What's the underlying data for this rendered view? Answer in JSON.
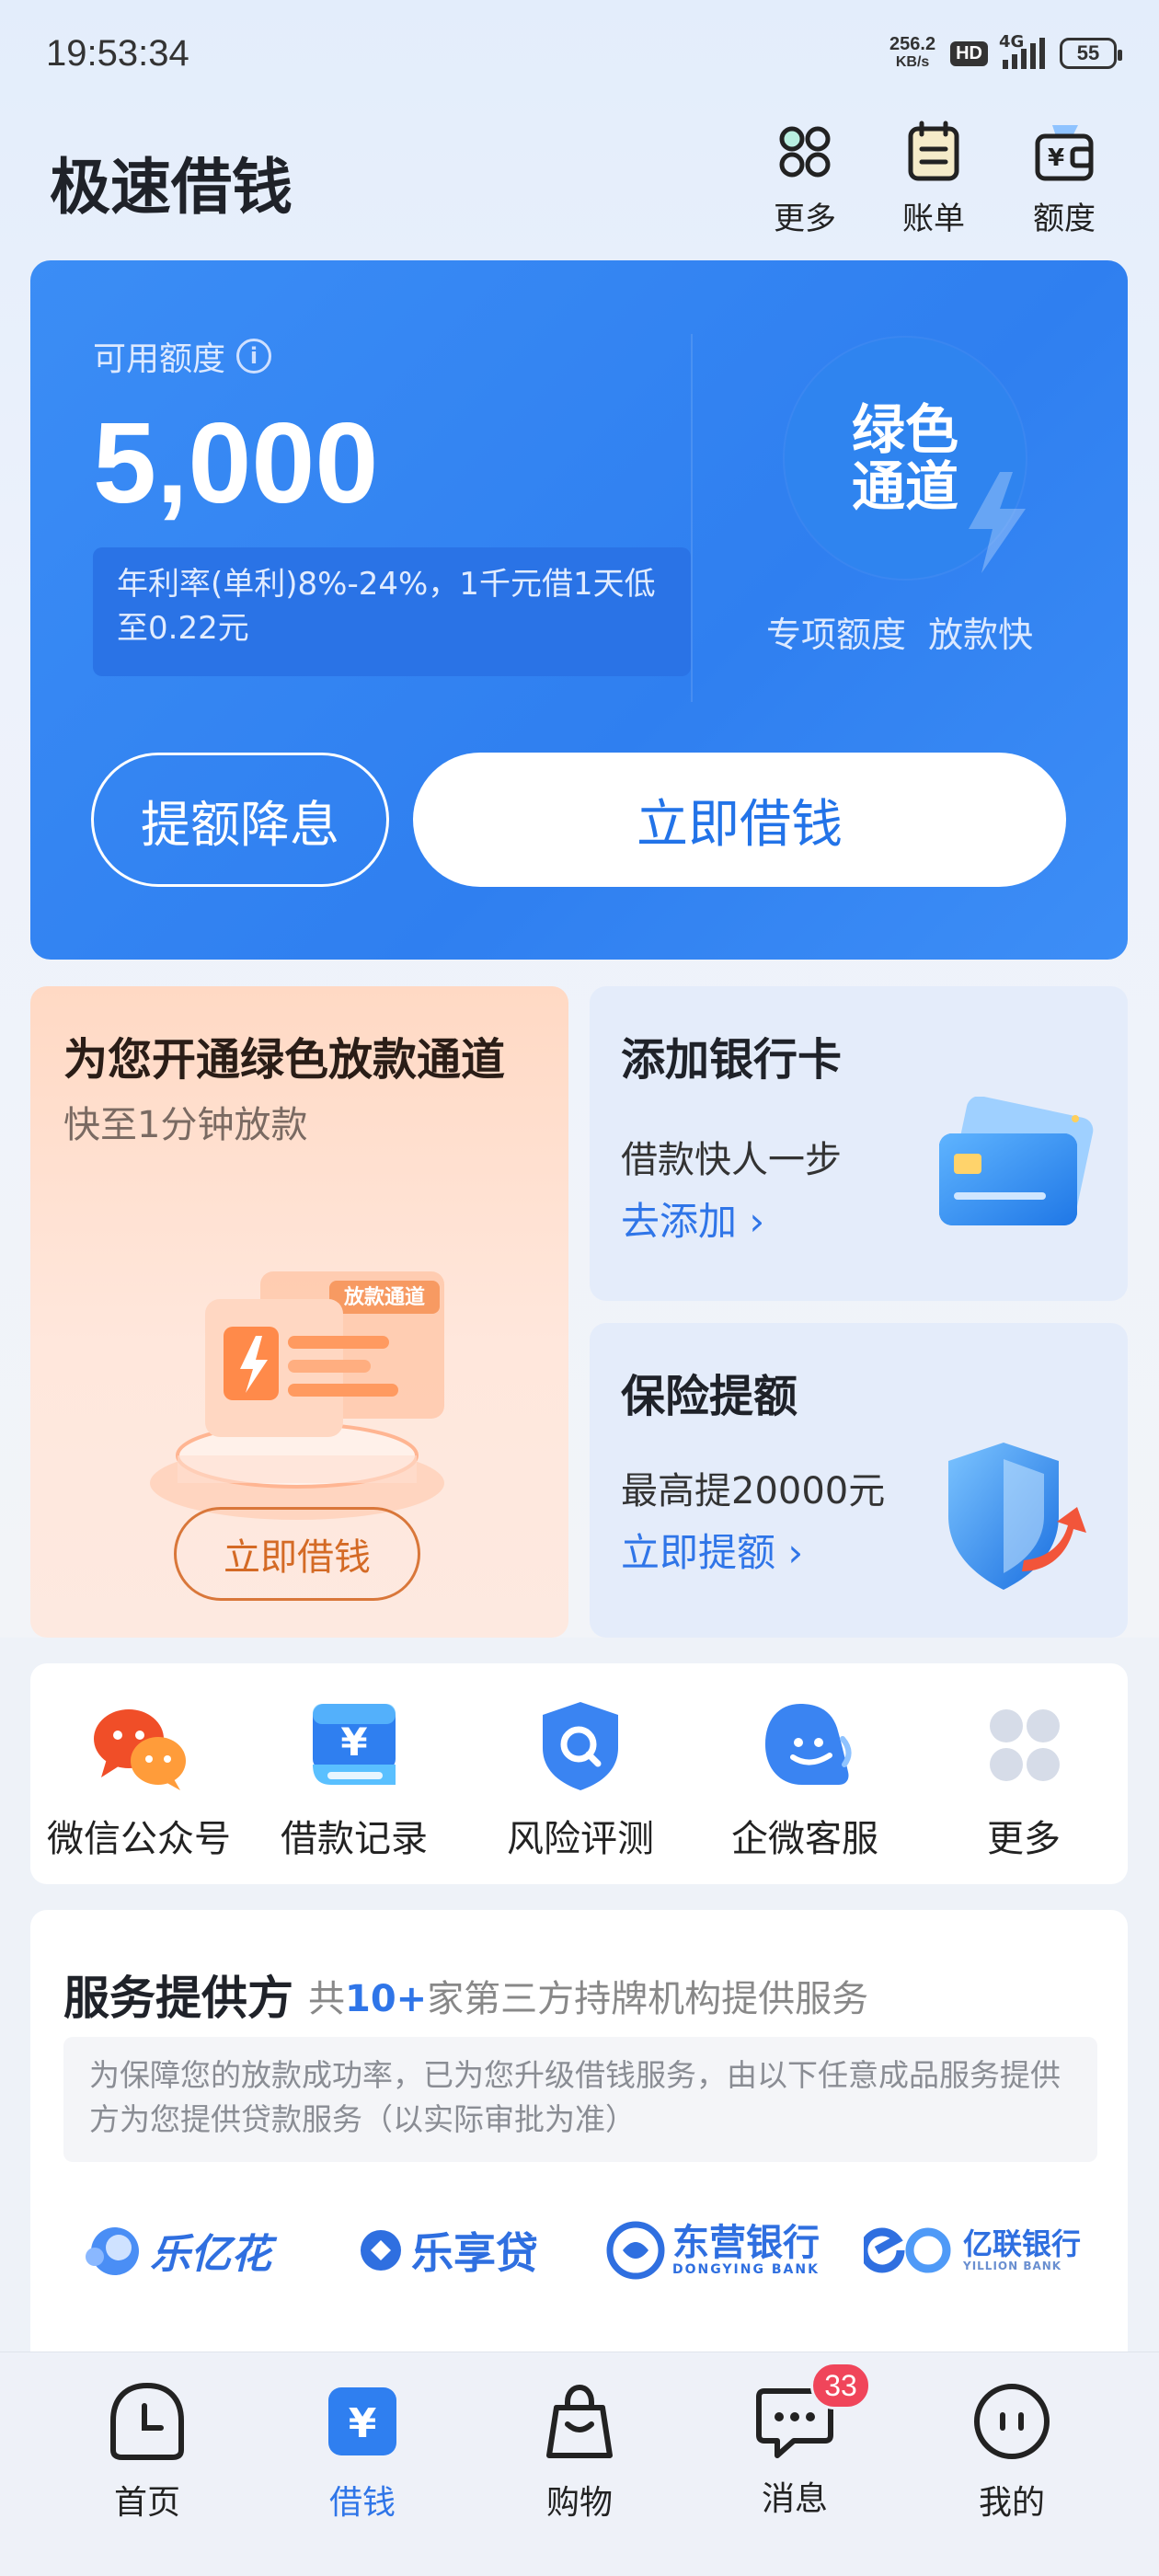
{
  "status_bar": {
    "time": "19:53:34",
    "net_speed": "256.2",
    "net_unit": "KB/s",
    "hd": "HD",
    "network": "4G",
    "battery": "55"
  },
  "header": {
    "title": "极速借钱",
    "actions": [
      {
        "label": "更多",
        "icon": "more-grid-icon"
      },
      {
        "label": "账单",
        "icon": "bill-icon"
      },
      {
        "label": "额度",
        "icon": "wallet-icon"
      }
    ]
  },
  "credit_card": {
    "available_label": "可用额度",
    "info_icon": "ⓘ",
    "amount": "5,000",
    "rate_text": "年利率(单利)8%-24%，1千元借1天低至0.22元",
    "green_channel_line1": "绿色",
    "green_channel_line2": "通道",
    "green_channel_sub": "专项额度  放款快",
    "raise_button": "提额降息",
    "borrow_button": "立即借钱",
    "colors": {
      "card_bg": "#3488f3",
      "accent": "#2273e8"
    }
  },
  "promo": {
    "title": "为您开通绿色放款通道",
    "subtitle": "快至1分钟放款",
    "illus_tag": "放款通道",
    "button": "立即借钱"
  },
  "bank_card": {
    "title": "添加银行卡",
    "desc": "借款快人一步",
    "link": "去添加",
    "chevron": "›"
  },
  "insurance": {
    "title": "保险提额",
    "desc": "最高提20000元",
    "link": "立即提额",
    "chevron": "›"
  },
  "tools": [
    {
      "label": "微信公众号",
      "icon": "wechat-icon"
    },
    {
      "label": "借款记录",
      "icon": "loan-record-icon"
    },
    {
      "label": "风险评测",
      "icon": "risk-assessment-icon"
    },
    {
      "label": "企微客服",
      "icon": "customer-service-icon"
    },
    {
      "label": "更多",
      "icon": "more-dots-icon"
    }
  ],
  "provider": {
    "title": "服务提供方",
    "sub_prefix": "共",
    "sub_count": "10+",
    "sub_suffix": "家第三方持牌机构提供服务",
    "note": "为保障您的放款成功率，已为您升级借钱服务，由以下任意成品服务提供方为您提供贷款服务（以实际审批为准）",
    "logos": [
      {
        "name": "乐亿花"
      },
      {
        "name": "乐享贷"
      },
      {
        "name": "东营银行",
        "en": "DONGYING BANK"
      },
      {
        "name": "亿联银行",
        "en": "YILLION BANK"
      }
    ]
  },
  "tabbar": {
    "items": [
      {
        "label": "首页",
        "icon": "home-clock-icon"
      },
      {
        "label": "借钱",
        "icon": "yuan-icon",
        "active": true
      },
      {
        "label": "购物",
        "icon": "shopping-bag-icon"
      },
      {
        "label": "消息",
        "icon": "message-icon",
        "badge": "33"
      },
      {
        "label": "我的",
        "icon": "profile-icon"
      }
    ]
  }
}
